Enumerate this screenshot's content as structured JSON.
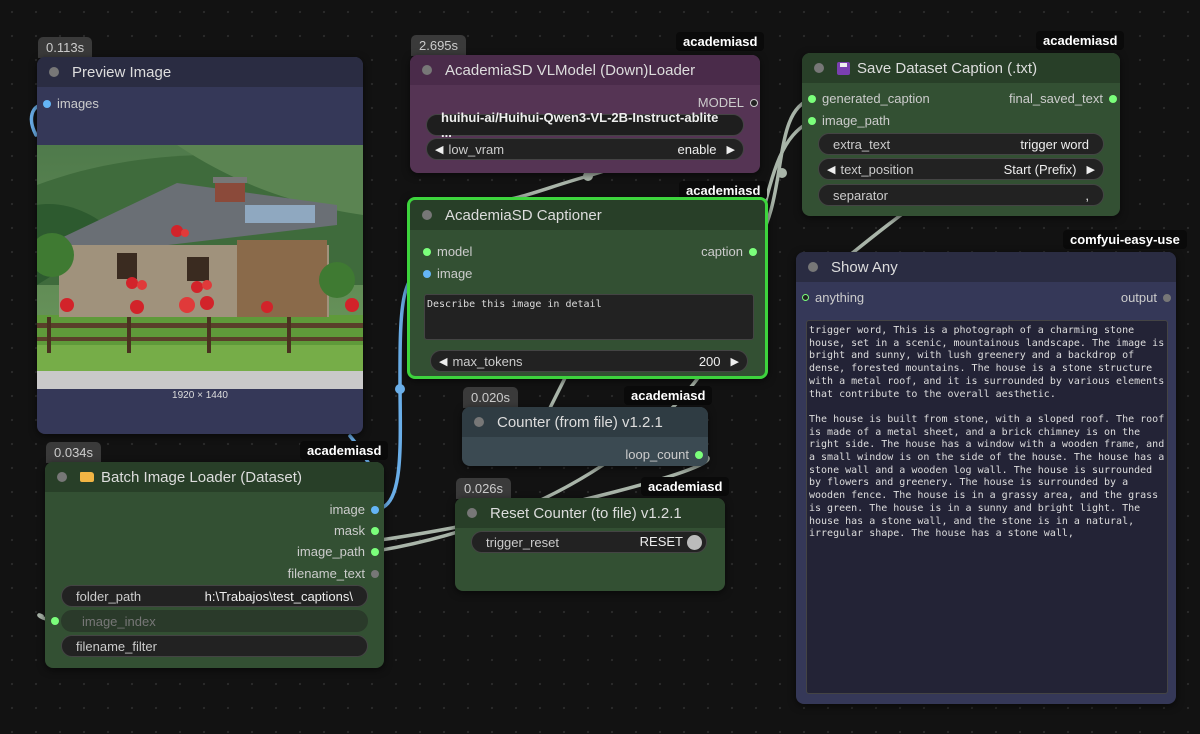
{
  "nodes": {
    "preview": {
      "timing": "0.113s",
      "title": "Preview Image",
      "input": "images",
      "image_size": "1920 × 1440"
    },
    "vlloader": {
      "timing": "2.695s",
      "badge": "academiasd",
      "title": "AcademiaSD VLModel (Down)Loader",
      "output": "MODEL",
      "model_value": "huihui-ai/Huihui-Qwen3-VL-2B-Instruct-ablite ...",
      "low_vram_label": "low_vram",
      "low_vram_value": "enable"
    },
    "captioner": {
      "badge": "academiasd",
      "title": "AcademiaSD Captioner",
      "input_model": "model",
      "input_image": "image",
      "output": "caption",
      "prompt": "Describe this image in detail",
      "max_tokens_label": "max_tokens",
      "max_tokens_value": "200"
    },
    "save": {
      "badge": "academiasd",
      "title": "Save Dataset Caption (.txt)",
      "input_caption": "generated_caption",
      "input_path": "image_path",
      "output": "final_saved_text",
      "extra_text_label": "extra_text",
      "extra_text_value": "trigger word",
      "text_position_label": "text_position",
      "text_position_value": "Start (Prefix)",
      "separator_label": "separator",
      "separator_value": ","
    },
    "showany": {
      "badge": "comfyui-easy-use",
      "title": "Show Any",
      "input": "anything",
      "output": "output",
      "text": "trigger word, This is a photograph of a charming stone house, set in a scenic, mountainous landscape. The image is bright and sunny, with lush greenery and a backdrop of dense, forested mountains. The house is a stone structure with a metal roof, and it is surrounded by various elements that contribute to the overall aesthetic.\n\nThe house is built from stone, with a sloped roof. The roof is made of a metal sheet, and a brick chimney is on the right side. The house has a window with a wooden frame, and a small window is on the side of the house. The house has a stone wall and a wooden log wall. The house is surrounded by flowers and greenery. The house is surrounded by a wooden fence. The house is in a grassy area, and the grass is green. The house is in a sunny and bright light. The house has a stone wall, and the stone is in a natural, irregular shape. The house has a stone wall,"
    },
    "counter": {
      "timing": "0.020s",
      "badge": "academiasd",
      "title": "Counter (from file) v1.2.1",
      "output": "loop_count"
    },
    "reset": {
      "timing": "0.026s",
      "badge": "academiasd",
      "title": "Reset Counter (to file) v1.2.1",
      "trigger_label": "trigger_reset",
      "trigger_value": "RESET"
    },
    "batch": {
      "timing": "0.034s",
      "badge": "academiasd",
      "title": "Batch Image Loader (Dataset)",
      "outputs": [
        "image",
        "mask",
        "image_path",
        "filename_text"
      ],
      "folder_label": "folder_path",
      "folder_value": "h:\\Trabajos\\test_captions\\",
      "index_label": "image_index",
      "filter_label": "filename_filter"
    }
  },
  "colors": {
    "image_slot": "#64b5f6",
    "green_slot": "#7bff7b",
    "selected_border": "#3dd43d",
    "link_image": "#6aaee8",
    "link_other": "#a9b5a9"
  },
  "icons": {
    "save": "floppy-disk-icon",
    "batch": "folder-icon"
  }
}
